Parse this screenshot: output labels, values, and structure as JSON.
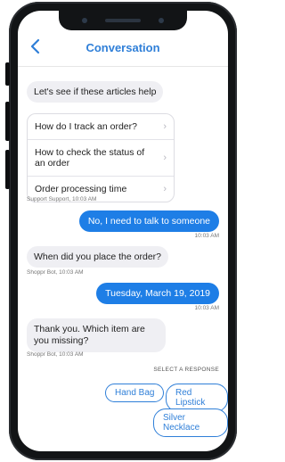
{
  "header": {
    "title": "Conversation"
  },
  "messages": {
    "bot_intro": "Let's see if these articles help",
    "articles": [
      "How do I track an order?",
      "How to check the status of an order",
      "Order processing time"
    ],
    "articles_meta": "Support Support, 10:03 AM",
    "user_1": "No, I need to talk to someone",
    "user_1_meta": "10:03 AM",
    "bot_2": "When did you place the order?",
    "bot_2_meta": "Shoppr Bot, 10:03 AM",
    "user_2": "Tuesday, March 19, 2019",
    "user_2_meta": "10:03 AM",
    "bot_3": "Thank you. Which item are you missing?",
    "bot_3_meta": "Shoppr Bot, 10:03 AM"
  },
  "responses": {
    "label": "SELECT A RESPONSE",
    "options": [
      "Hand Bag",
      "Red Lipstick",
      "Silver Necklace"
    ]
  },
  "icons": {
    "back": "chevron-left-icon",
    "article_arrow": "chevron-right-icon"
  },
  "colors": {
    "accent": "#2f7fd8",
    "user_bubble": "#1e7ee6",
    "bot_bubble": "#efeff3"
  }
}
